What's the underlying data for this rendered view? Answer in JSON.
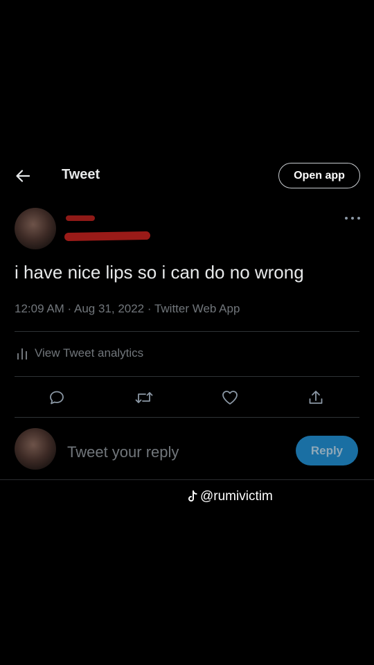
{
  "header": {
    "back_icon": "arrow-left-icon",
    "title": "Tweet",
    "open_app_label": "Open app"
  },
  "tweet": {
    "text": "i have nice lips so i can do no wrong",
    "timestamp": "12:09 AM · Aug 31, 2022 · Twitter Web App",
    "analytics_label": "View Tweet analytics"
  },
  "actions": [
    "reply-icon",
    "retweet-icon",
    "like-icon",
    "share-icon"
  ],
  "reply_box": {
    "placeholder": "Tweet your reply",
    "button_label": "Reply"
  },
  "watermark": {
    "icon": "tiktok-icon",
    "handle": "@rumivictim"
  },
  "colors": {
    "background": "#000000",
    "text": "#e7e9ea",
    "secondary_text": "#71767b",
    "reply_button": "#1a6fa3",
    "redaction": "#9a1b18"
  }
}
